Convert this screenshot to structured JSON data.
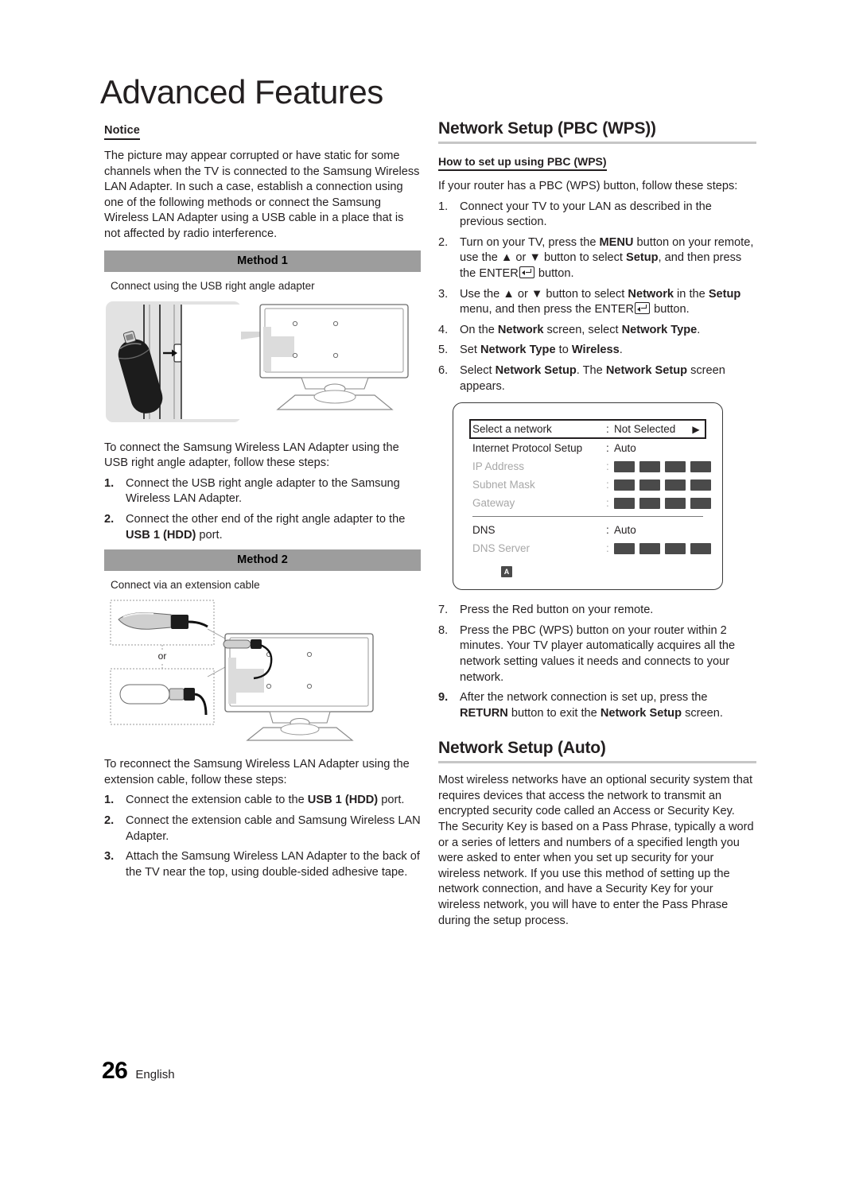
{
  "page": {
    "title": "Advanced Features",
    "footer_number": "26",
    "footer_language": "English"
  },
  "left_column": {
    "notice": {
      "heading": "Notice",
      "body": "The picture may appear corrupted or have static for some channels when the TV is connected to the Samsung Wireless LAN Adapter. In such a case, establish a connection using one of the following methods or connect the Samsung Wireless LAN Adapter using a USB cable in a place that is not affected by radio interference."
    },
    "method1": {
      "bar_label": "Method 1",
      "caption": "Connect using the USB right angle adapter",
      "intro": "To connect the Samsung Wireless LAN Adapter using the USB right angle adapter, follow these steps:",
      "steps": [
        {
          "num": "1.",
          "text_pre": "Connect the USB right angle adapter to the Samsung Wireless LAN Adapter.",
          "bold": "",
          "text_post": ""
        },
        {
          "num": "2.",
          "text_pre": "Connect the other end of the right angle adapter to the ",
          "bold": "USB 1 (HDD)",
          "text_post": " port."
        }
      ]
    },
    "method2": {
      "bar_label": "Method 2",
      "caption": "Connect via an extension cable",
      "figure_or_label": "or",
      "intro": "To reconnect the Samsung Wireless LAN Adapter using the extension cable, follow these steps:",
      "steps": [
        {
          "num": "1.",
          "text_pre": "Connect the extension cable to the ",
          "bold": "USB 1 (HDD)",
          "text_post": " port."
        },
        {
          "num": "2.",
          "text_pre": "Connect the extension cable and Samsung Wireless LAN Adapter.",
          "bold": "",
          "text_post": ""
        },
        {
          "num": "3.",
          "text_pre": "Attach the Samsung Wireless LAN Adapter to the back of the TV near the top, using double-sided adhesive tape.",
          "bold": "",
          "text_post": ""
        }
      ]
    }
  },
  "right_column": {
    "section_pbc": {
      "heading": "Network Setup (PBC (WPS))",
      "subheading": "How to set up using PBC (WPS)",
      "intro": "If your router has a PBC (WPS) button, follow these steps:"
    },
    "osd": {
      "rows": [
        {
          "label": "Select a network",
          "colon": ":",
          "value": "Not Selected",
          "arrow": "▶",
          "selected": true,
          "dim": false,
          "blocks": 0
        },
        {
          "label": "Internet Protocol Setup",
          "colon": ":",
          "value": "Auto",
          "arrow": "",
          "selected": false,
          "dim": false,
          "blocks": 0
        },
        {
          "label": "IP Address",
          "colon": ":",
          "value": "",
          "arrow": "",
          "selected": false,
          "dim": true,
          "blocks": 4
        },
        {
          "label": "Subnet Mask",
          "colon": ":",
          "value": "",
          "arrow": "",
          "selected": false,
          "dim": true,
          "blocks": 4
        },
        {
          "label": "Gateway",
          "colon": ":",
          "value": "",
          "arrow": "",
          "selected": false,
          "dim": true,
          "blocks": 4
        }
      ],
      "rows_after_divider": [
        {
          "label": "DNS",
          "colon": ":",
          "value": "Auto",
          "arrow": "",
          "selected": false,
          "dim": false,
          "blocks": 0
        },
        {
          "label": "DNS Server",
          "colon": ":",
          "value": "",
          "arrow": "",
          "selected": false,
          "dim": true,
          "blocks": 4
        }
      ],
      "footer_key": "A"
    },
    "section_auto": {
      "heading": "Network Setup (Auto)",
      "body": "Most wireless networks have an optional security system that requires devices that access the network to transmit an encrypted security code called an Access or Security Key. The Security Key is based on a Pass Phrase, typically a word or a series of letters and numbers of a specified length you were asked to enter when you set up security for your wireless network. If you use this method of setting up the network connection, and have a Security Key for your wireless network, you will have to enter the Pass Phrase during the setup process."
    }
  },
  "colors": {
    "method_bar_bg": "#9d9d9d",
    "rule_gray": "#c6c6c6",
    "dim_text": "#a7a7a7",
    "osd_block": "#4a4a4a",
    "body_text": "#231f20"
  }
}
